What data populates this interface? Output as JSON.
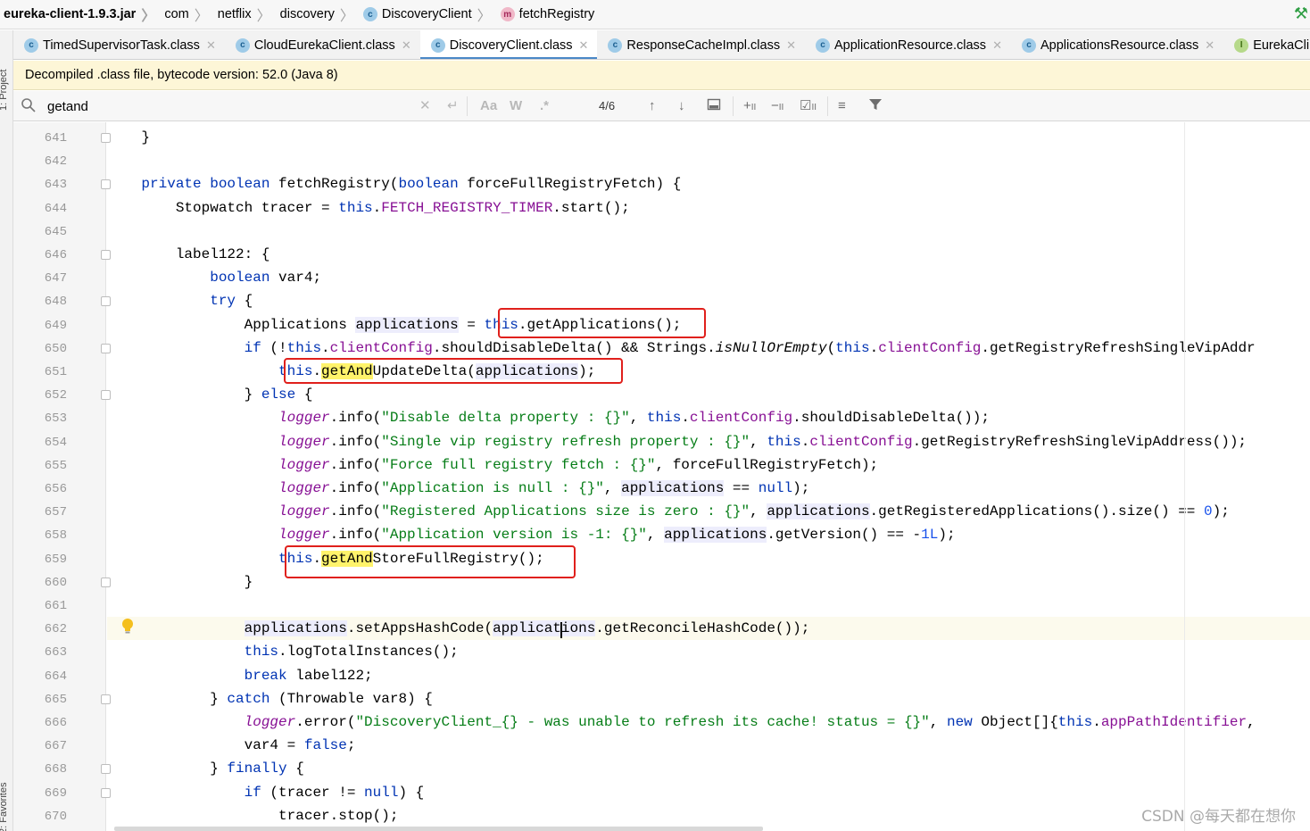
{
  "breadcrumb": {
    "items": [
      {
        "label": "eureka-client-1.9.3.jar",
        "icon": null
      },
      {
        "label": "com",
        "icon": null
      },
      {
        "label": "netflix",
        "icon": null
      },
      {
        "label": "discovery",
        "icon": null
      },
      {
        "label": "DiscoveryClient",
        "icon": "class-icon"
      },
      {
        "label": "fetchRegistry",
        "icon": "method-icon"
      }
    ]
  },
  "sidebar": {
    "project_label": "1: Project",
    "favorites_label": "2: Favorites"
  },
  "tabs": [
    {
      "label": "TimedSupervisorTask.class",
      "icon": "class-icon",
      "active": false
    },
    {
      "label": "CloudEurekaClient.class",
      "icon": "class-icon",
      "active": false
    },
    {
      "label": "DiscoveryClient.class",
      "icon": "class-icon",
      "active": true
    },
    {
      "label": "ResponseCacheImpl.class",
      "icon": "class-icon",
      "active": false
    },
    {
      "label": "ApplicationResource.class",
      "icon": "class-icon",
      "active": false
    },
    {
      "label": "ApplicationsResource.class",
      "icon": "class-icon",
      "active": false
    },
    {
      "label": "EurekaCli",
      "icon": "interface-icon",
      "active": false
    }
  ],
  "banner": {
    "text": "Decompiled .class file, bytecode version: 52.0 (Java 8)"
  },
  "search": {
    "query": "getand",
    "match_count": "4/6",
    "match_case_label": "Aa",
    "words_label": "W",
    "regex_label": ".*"
  },
  "editor": {
    "current_line": "662",
    "lines": [
      {
        "n": "641",
        "fold": true,
        "html": "    }"
      },
      {
        "n": "642",
        "fold": false,
        "html": ""
      },
      {
        "n": "643",
        "fold": true,
        "html": "    <span class=\"kw\">private boolean</span> fetchRegistry(<span class=\"kw\">boolean</span> forceFullRegistryFetch) {"
      },
      {
        "n": "644",
        "fold": false,
        "html": "        Stopwatch tracer = <span class=\"kw\">this</span>.<span class=\"fld\">FETCH_REGISTRY_TIMER</span>.start();"
      },
      {
        "n": "645",
        "fold": false,
        "html": ""
      },
      {
        "n": "646",
        "fold": true,
        "html": "        label122: {"
      },
      {
        "n": "647",
        "fold": false,
        "html": "            <span class=\"kw\">boolean</span> var4;"
      },
      {
        "n": "648",
        "fold": true,
        "html": "            <span class=\"kw\">try</span> {"
      },
      {
        "n": "649",
        "fold": false,
        "html": "                Applications <span class=\"vu\">applications</span> = <span class=\"kw\">this</span>.getApplications();"
      },
      {
        "n": "650",
        "fold": true,
        "html": "                <span class=\"kw\">if</span> (!<span class=\"kw\">this</span>.<span class=\"fld\">clientConfig</span>.shouldDisableDelta() &amp;&amp; Strings.<span class=\"it\">isNullOrEmpty</span>(<span class=\"kw\">this</span>.<span class=\"fld\">clientConfig</span>.getRegistryRefreshSingleVipAddr"
      },
      {
        "n": "651",
        "fold": false,
        "html": "                    <span class=\"kw\">this</span>.<span class=\"hl\">getAnd</span>UpdateDelta(<span class=\"vu\">applications</span>);"
      },
      {
        "n": "652",
        "fold": true,
        "html": "                } <span class=\"kw\">else</span> {"
      },
      {
        "n": "653",
        "fold": false,
        "html": "                    <span class=\"fld it\">logger</span>.info(<span class=\"str\">\"Disable delta property : {}\"</span>, <span class=\"kw\">this</span>.<span class=\"fld\">clientConfig</span>.shouldDisableDelta());"
      },
      {
        "n": "654",
        "fold": false,
        "html": "                    <span class=\"fld it\">logger</span>.info(<span class=\"str\">\"Single vip registry refresh property : {}\"</span>, <span class=\"kw\">this</span>.<span class=\"fld\">clientConfig</span>.getRegistryRefreshSingleVipAddress());"
      },
      {
        "n": "655",
        "fold": false,
        "html": "                    <span class=\"fld it\">logger</span>.info(<span class=\"str\">\"Force full registry fetch : {}\"</span>, forceFullRegistryFetch);"
      },
      {
        "n": "656",
        "fold": false,
        "html": "                    <span class=\"fld it\">logger</span>.info(<span class=\"str\">\"Application is null : {}\"</span>, <span class=\"vu\">applications</span> == <span class=\"kw\">null</span>);"
      },
      {
        "n": "657",
        "fold": false,
        "html": "                    <span class=\"fld it\">logger</span>.info(<span class=\"str\">\"Registered Applications size is zero : {}\"</span>, <span class=\"vu\">applications</span>.getRegisteredApplications().size() == <span class=\"num\">0</span>);"
      },
      {
        "n": "658",
        "fold": false,
        "html": "                    <span class=\"fld it\">logger</span>.info(<span class=\"str\">\"Application version is -1: {}\"</span>, <span class=\"vu\">applications</span>.getVersion() == -<span class=\"num\">1L</span>);"
      },
      {
        "n": "659",
        "fold": false,
        "html": "                    <span class=\"kw\">this</span>.<span class=\"hl\">getAnd</span>StoreFullRegistry();"
      },
      {
        "n": "660",
        "fold": true,
        "html": "                }"
      },
      {
        "n": "661",
        "fold": false,
        "html": ""
      },
      {
        "n": "662",
        "fold": false,
        "html": "                <span class=\"vu\">applications</span>.setAppsHashCode(<span class=\"vu\">applications</span>.getReconcileHashCode());"
      },
      {
        "n": "663",
        "fold": false,
        "html": "                <span class=\"kw\">this</span>.logTotalInstances();"
      },
      {
        "n": "664",
        "fold": false,
        "html": "                <span class=\"kw\">break</span> label122;"
      },
      {
        "n": "665",
        "fold": true,
        "html": "            } <span class=\"kw\">catch</span> (Throwable var8) {"
      },
      {
        "n": "666",
        "fold": false,
        "html": "                <span class=\"fld it\">logger</span>.error(<span class=\"str\">\"DiscoveryClient_{} - was unable to refresh its cache! status = {}\"</span>, <span class=\"kw\">new</span> Object[]{<span class=\"kw\">this</span>.<span class=\"fld\">appPathIdentifier</span>,"
      },
      {
        "n": "667",
        "fold": false,
        "html": "                var4 = <span class=\"kw\">false</span>;"
      },
      {
        "n": "668",
        "fold": true,
        "html": "            } <span class=\"kw\">finally</span> {"
      },
      {
        "n": "669",
        "fold": true,
        "html": "                <span class=\"kw\">if</span> (tracer != <span class=\"kw\">null</span>) {"
      },
      {
        "n": "670",
        "fold": false,
        "html": "                    tracer.stop();"
      }
    ]
  },
  "watermark": "CSDN @每天都在想你",
  "colors": {
    "annotation_box": "#e0201c",
    "search_highlight": "#fff36b",
    "keyword": "#0033b3",
    "field": "#871094",
    "string": "#067d17"
  }
}
